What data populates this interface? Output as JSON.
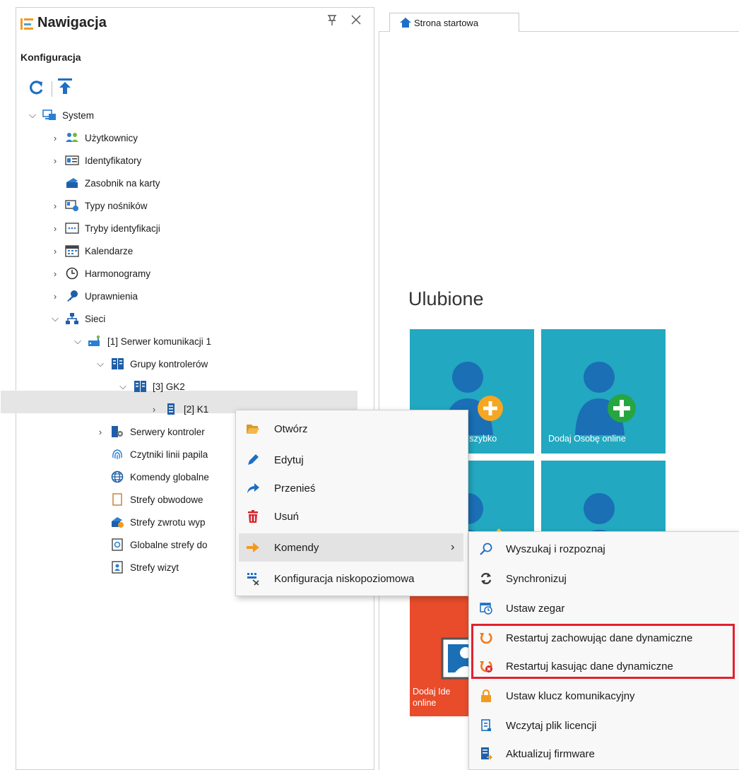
{
  "nav": {
    "title": "Nawigacja",
    "section": "Konfiguracja",
    "icons": [
      "list-icon",
      "pin-icon",
      "close-icon",
      "refresh-icon",
      "collapse-all-icon"
    ]
  },
  "tree": [
    {
      "label": "System",
      "icon": "system-icon"
    },
    {
      "label": "Użytkownicy",
      "icon": "users-icon"
    },
    {
      "label": "Identyfikatory",
      "icon": "id-card-icon"
    },
    {
      "label": "Zasobnik na karty",
      "icon": "card-box-icon"
    },
    {
      "label": "Typy nośników",
      "icon": "media-type-icon"
    },
    {
      "label": "Tryby identyfikacji",
      "icon": "id-mode-icon"
    },
    {
      "label": "Kalendarze",
      "icon": "calendar-icon"
    },
    {
      "label": "Harmonogramy",
      "icon": "clock-icon"
    },
    {
      "label": "Uprawnienia",
      "icon": "key-icon"
    },
    {
      "label": "Sieci",
      "icon": "network-icon"
    },
    {
      "label": "[1] Serwer komunikacji 1",
      "icon": "server-icon"
    },
    {
      "label": "Grupy kontrolerów",
      "icon": "controller-group-icon"
    },
    {
      "label": "[3] GK2",
      "icon": "controller-group-icon"
    },
    {
      "label": "[2] K1",
      "icon": "controller-icon"
    },
    {
      "label": "Serwery kontroler",
      "icon": "controller-server-icon"
    },
    {
      "label": "Czytniki linii papila",
      "icon": "fingerprint-icon"
    },
    {
      "label": "Komendy globalne",
      "icon": "globe-icon"
    },
    {
      "label": "Strefy obwodowe",
      "icon": "zone-icon"
    },
    {
      "label": "Strefy zwrotu wyp",
      "icon": "return-zone-icon"
    },
    {
      "label": "Globalne strefy do",
      "icon": "global-zone-icon"
    },
    {
      "label": "Strefy wizyt",
      "icon": "visit-zone-icon"
    }
  ],
  "tab": {
    "label": "Strona startowa",
    "icon": "home-icon"
  },
  "favorites": {
    "title": "Ulubione",
    "tiles": [
      {
        "label": "obę szybko"
      },
      {
        "label": "Dodaj Osobę online"
      },
      {
        "label": "Dodaj Ide",
        "label2": "online"
      }
    ]
  },
  "context_menu": [
    {
      "label": "Otwórz",
      "icon": "folder-open-icon"
    },
    {
      "label": "Edytuj",
      "icon": "pencil-icon"
    },
    {
      "label": "Przenieś",
      "icon": "move-arrow-icon"
    },
    {
      "label": "Usuń",
      "icon": "trash-icon"
    },
    {
      "label": "Komendy",
      "icon": "arrow-right-icon",
      "submenu_arrow": "›"
    },
    {
      "label": "Konfiguracja niskopoziomowa",
      "icon": "low-level-config-icon"
    }
  ],
  "submenu": [
    {
      "label": "Wyszukaj i rozpoznaj",
      "icon": "search-icon"
    },
    {
      "label": "Synchronizuj",
      "icon": "sync-icon"
    },
    {
      "label": "Ustaw zegar",
      "icon": "set-clock-icon"
    },
    {
      "label": "Restartuj zachowując dane dynamiczne",
      "icon": "restart-icon"
    },
    {
      "label": "Restartuj kasując dane dynamiczne",
      "icon": "restart-delete-icon"
    },
    {
      "label": "Ustaw klucz komunikacyjny",
      "icon": "lock-icon"
    },
    {
      "label": "Wczytaj plik licencji",
      "icon": "license-icon"
    },
    {
      "label": "Aktualizuj firmware",
      "icon": "firmware-icon"
    }
  ],
  "colors": {
    "accent": "#1e6fc4",
    "tile": "#22a8c0",
    "tile_red": "#e84c2b",
    "highlight_box": "#e2212f"
  }
}
